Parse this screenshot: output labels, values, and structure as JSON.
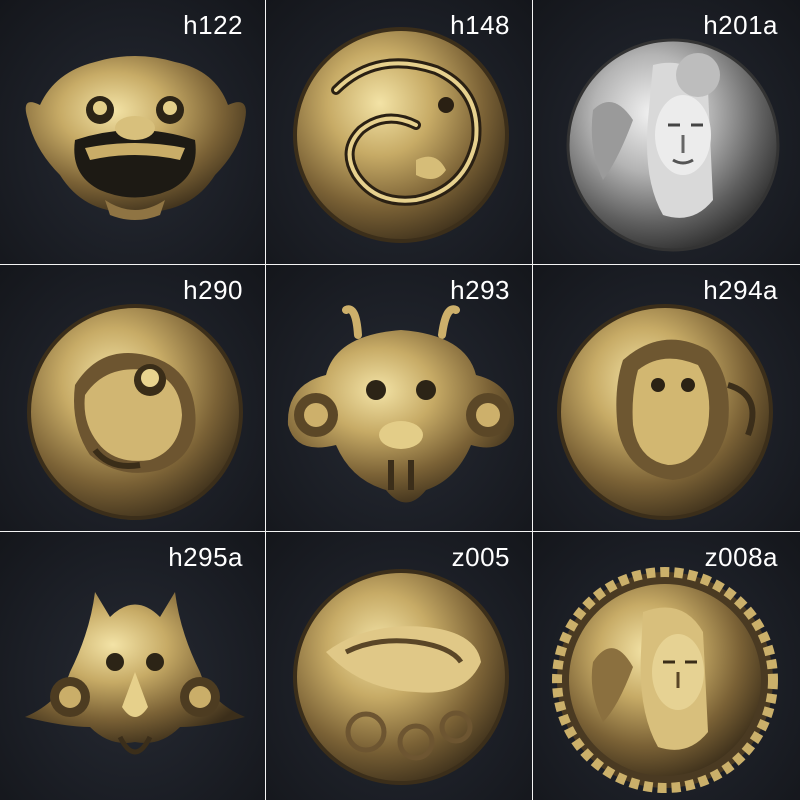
{
  "products": [
    {
      "code": "h122",
      "subject": "lion-face",
      "finish": "brass"
    },
    {
      "code": "h148",
      "subject": "dragon-round",
      "finish": "brass"
    },
    {
      "code": "h201a",
      "subject": "buddha-face",
      "finish": "silver"
    },
    {
      "code": "h290",
      "subject": "foo-dog-round",
      "finish": "brass"
    },
    {
      "code": "h293",
      "subject": "dragon-head",
      "finish": "brass"
    },
    {
      "code": "h294a",
      "subject": "warrior-round",
      "finish": "brass"
    },
    {
      "code": "h295a",
      "subject": "garuda-mask",
      "finish": "brass"
    },
    {
      "code": "z005",
      "subject": "qilin-clouds",
      "finish": "brass"
    },
    {
      "code": "z008a",
      "subject": "buddha-rope-border",
      "finish": "brass"
    }
  ],
  "colors": {
    "background": "#1b1e25",
    "brass": "#b69a5c",
    "brass_dark": "#4a3a22",
    "silver": "#b8b8b8",
    "label": "#ffffff",
    "gutter": "#f4f4f4"
  }
}
